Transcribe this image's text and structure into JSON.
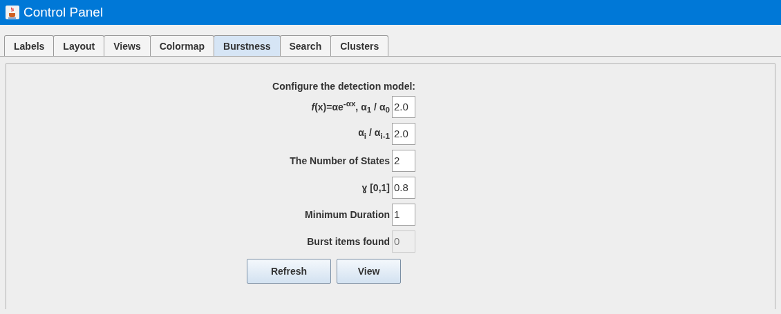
{
  "window": {
    "title": "Control Panel"
  },
  "tabs": [
    {
      "label": "Labels",
      "selected": false
    },
    {
      "label": "Layout",
      "selected": false
    },
    {
      "label": "Views",
      "selected": false
    },
    {
      "label": "Colormap",
      "selected": false
    },
    {
      "label": "Burstness",
      "selected": true
    },
    {
      "label": "Search",
      "selected": false
    },
    {
      "label": "Clusters",
      "selected": false
    }
  ],
  "heading": "Configure the detection model:",
  "fields": [
    {
      "label": "*f*(x)=αe$^{-αx}$, α$_{1}$ / α$_{0}$",
      "value": "2.0",
      "disabled": false
    },
    {
      "label": "α$_{i}$ / α$_{i-1}$",
      "value": "2.0",
      "disabled": false
    },
    {
      "label": "The Number of States",
      "value": "2",
      "disabled": false
    },
    {
      "label": "ɣ [0,1]",
      "value": "0.8",
      "disabled": false
    },
    {
      "label": "Minimum Duration",
      "value": "1",
      "disabled": false
    },
    {
      "label": "Burst items found",
      "value": "0",
      "disabled": true
    }
  ],
  "buttons": [
    "Refresh",
    "View"
  ]
}
